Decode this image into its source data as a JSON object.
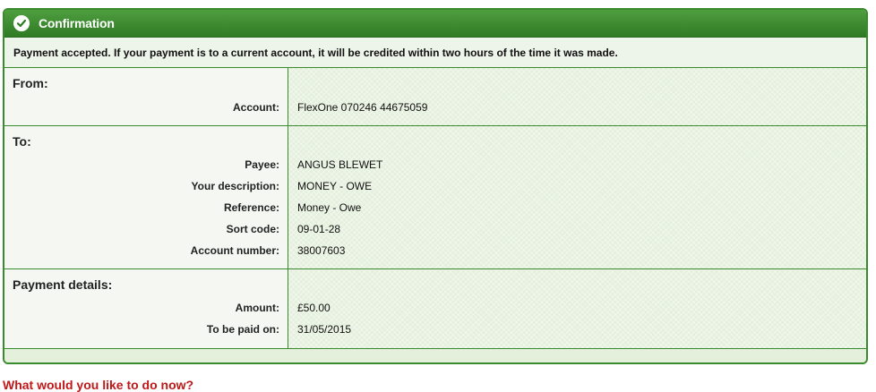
{
  "header": {
    "title": "Confirmation",
    "icon": "check-circle-icon"
  },
  "notice": "Payment accepted. If your payment is to a current account, it will be credited within two hours of the time it was made.",
  "from": {
    "title": "From:",
    "rows": [
      {
        "label": "Account:",
        "value": "FlexOne 070246 44675059"
      }
    ]
  },
  "to": {
    "title": "To:",
    "rows": [
      {
        "label": "Payee:",
        "value": "ANGUS BLEWET"
      },
      {
        "label": "Your description:",
        "value": "MONEY - OWE"
      },
      {
        "label": "Reference:",
        "value": "Money - Owe"
      },
      {
        "label": "Sort code:",
        "value": "09-01-28"
      },
      {
        "label": "Account number:",
        "value": "38007603"
      }
    ]
  },
  "payment": {
    "title": "Payment details:",
    "rows": [
      {
        "label": "Amount:",
        "value": "£50.00"
      },
      {
        "label": "To be paid on:",
        "value": "31/05/2015"
      }
    ]
  },
  "next_heading": "What would you like to do now?",
  "colors": {
    "accent": "#3a8a2e",
    "header_bg": "#2f7b25",
    "next_heading": "#c01818"
  }
}
